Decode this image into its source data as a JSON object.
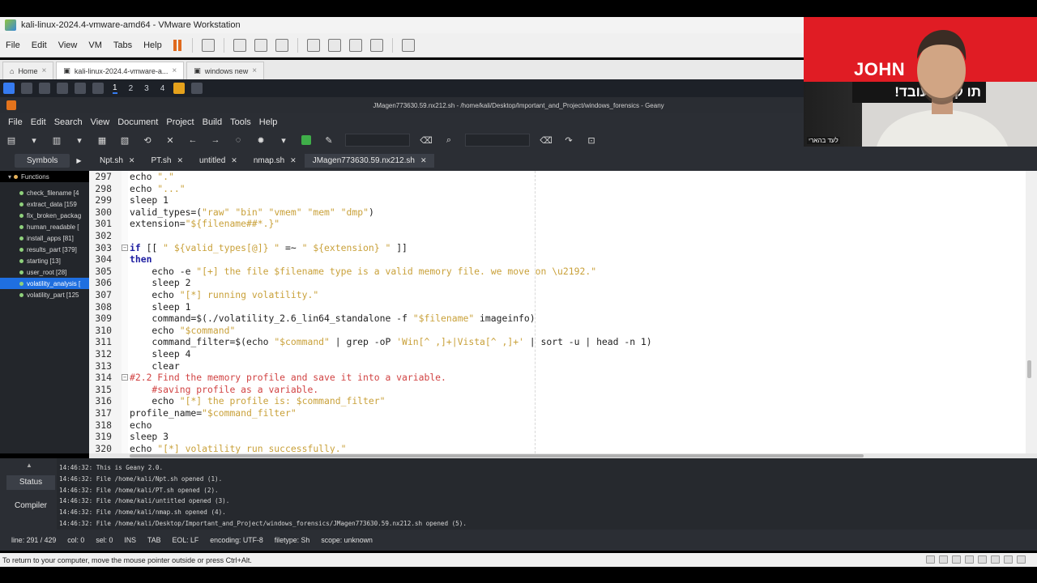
{
  "vmware": {
    "title": "kali-linux-2024.4-vmware-amd64 - VMware Workstation",
    "menu": [
      "File",
      "Edit",
      "View",
      "VM",
      "Tabs",
      "Help"
    ],
    "tabs": [
      {
        "label": "Home"
      },
      {
        "label": "kali-linux-2024.4-vmware-a..."
      },
      {
        "label": "windows new"
      }
    ],
    "bottom_hint": "To return to your computer, move the mouse pointer outside or press Ctrl+Alt."
  },
  "kali_panel": {
    "workspaces": [
      "1",
      "2",
      "3",
      "4"
    ]
  },
  "geany": {
    "title": "JMagen773630.59.nx212.sh - /home/kali/Desktop/Important_and_Project/windows_forensics - Geany",
    "menu": [
      "File",
      "Edit",
      "Search",
      "View",
      "Document",
      "Project",
      "Build",
      "Tools",
      "Help"
    ],
    "sidebar_tab": "Symbols",
    "symbols_root": "Functions",
    "symbols": [
      "check_filename [4",
      "extract_data [159",
      "fix_broken_packag",
      "human_readable [",
      "install_apps [81]",
      "results_part [379]",
      "starting [13]",
      "user_root [28]",
      "volatility_analysis [",
      "volatility_part [125"
    ],
    "selected_symbol_index": 8,
    "tabs": [
      {
        "label": "Npt.sh"
      },
      {
        "label": "PT.sh"
      },
      {
        "label": "untitled"
      },
      {
        "label": "nmap.sh"
      },
      {
        "label": "JMagen773630.59.nx212.sh"
      }
    ],
    "active_tab_index": 4,
    "code_lines": [
      {
        "n": "297",
        "text": "echo \".\""
      },
      {
        "n": "298",
        "text": "echo \"...\""
      },
      {
        "n": "299",
        "text": "sleep 1"
      },
      {
        "n": "300",
        "text": "valid_types=(\"raw\" \"bin\" \"vmem\" \"mem\" \"dmp\")"
      },
      {
        "n": "301",
        "text": "extension=\"${filename##*.}\""
      },
      {
        "n": "302",
        "text": ""
      },
      {
        "n": "303",
        "text": "if [[ \" ${valid_types[@]} \" =~ \" ${extension} \" ]]"
      },
      {
        "n": "304",
        "text": "then"
      },
      {
        "n": "305",
        "text": "    echo -e \"[+] the file $filename type is a valid memory file. we move on \\u2192.\""
      },
      {
        "n": "306",
        "text": "    sleep 2"
      },
      {
        "n": "307",
        "text": "    echo \"[*] running volatility.\""
      },
      {
        "n": "308",
        "text": "    sleep 1"
      },
      {
        "n": "309",
        "text": "    command=$(./volatility_2.6_lin64_standalone -f \"$filename\" imageinfo)"
      },
      {
        "n": "310",
        "text": "    echo \"$command\""
      },
      {
        "n": "311",
        "text": "    command_filter=$(echo \"$command\" | grep -oP 'Win[^ ,]+|Vista[^ ,]+' | sort -u | head -n 1)"
      },
      {
        "n": "312",
        "text": "    sleep 4"
      },
      {
        "n": "313",
        "text": "    clear"
      },
      {
        "n": "314",
        "text": "#2.2 Find the memory profile and save it into a variable."
      },
      {
        "n": "315",
        "text": "    #saving profile as a variable."
      },
      {
        "n": "316",
        "text": "    echo \"[*] the profile is: $command_filter\""
      },
      {
        "n": "317",
        "text": "profile_name=\"$command_filter\""
      },
      {
        "n": "318",
        "text": "echo"
      },
      {
        "n": "319",
        "text": "sleep 3"
      },
      {
        "n": "320",
        "text": "echo \"[*] volatility run successfully.\""
      }
    ],
    "messages_tabs": [
      "Status",
      "Compiler"
    ],
    "messages": [
      "14:46:32: This is Geany 2.0.",
      "14:46:32: File /home/kali/Npt.sh opened (1).",
      "14:46:32: File /home/kali/PT.sh opened (2).",
      "14:46:32: File /home/kali/untitled opened (3).",
      "14:46:32: File /home/kali/nmap.sh opened (4).",
      "14:46:32: File /home/kali/Desktop/Important_and_Project/windows_forensics/JMagen773630.59.nx212.sh opened (5)."
    ],
    "status": {
      "line": "line: 291 / 429",
      "col": "col: 0",
      "sel": "sel: 0",
      "ins": "INS",
      "tab": "TAB",
      "eol": "EOL: LF",
      "encoding": "encoding: UTF-8",
      "filetype": "filetype: Sh",
      "scope": "scope: unknown"
    }
  },
  "overlay": {
    "name": "JOHN",
    "subtitle_visible": "תו ק, זה עובד!",
    "label": "לעד בהארי"
  }
}
